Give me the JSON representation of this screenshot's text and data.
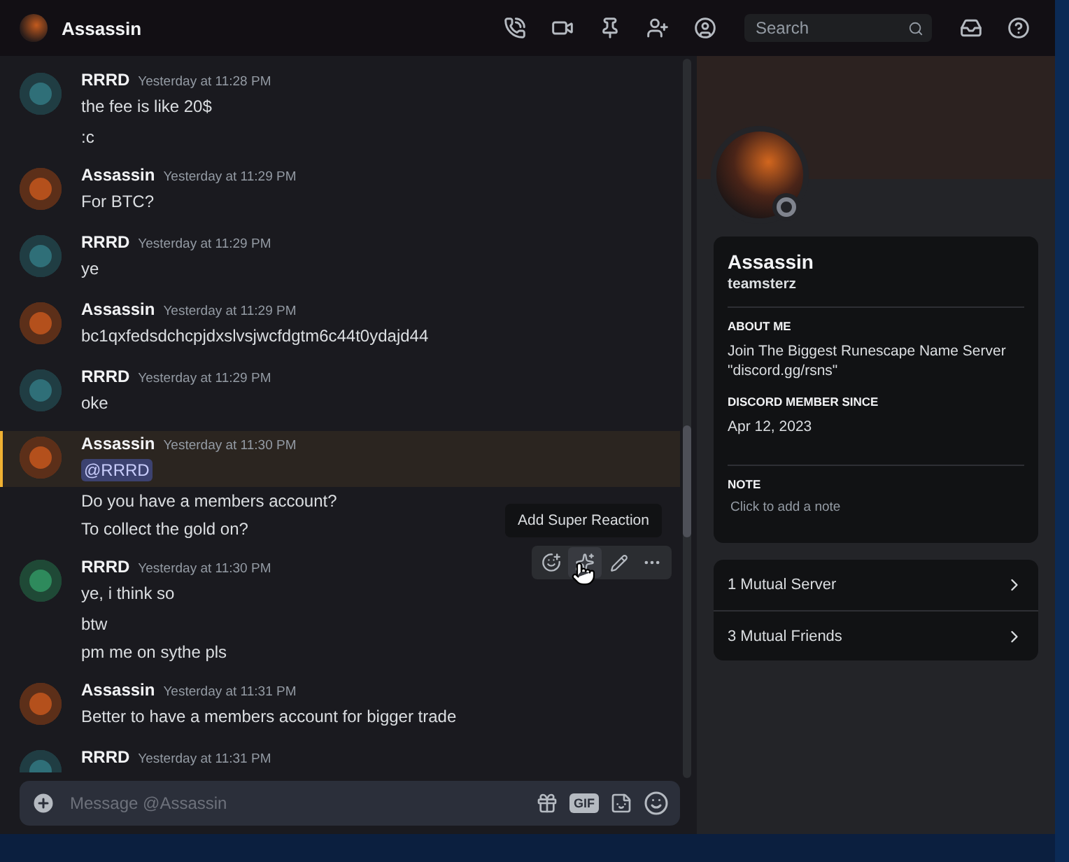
{
  "header": {
    "title": "Assassin",
    "search": {
      "placeholder": "Search"
    }
  },
  "messages": [
    {
      "author": "RRRD",
      "color": "#2f6f78",
      "time": "Yesterday at 11:28 PM",
      "lines": [
        {
          "text": "the fee is like 20$",
          "kind": "text",
          "highlighted": false
        },
        {
          "text": ":c",
          "kind": "text",
          "highlighted": false
        }
      ]
    },
    {
      "author": "Assassin",
      "color": "#b4501c",
      "time": "Yesterday at 11:29 PM",
      "lines": [
        {
          "text": "For BTC?",
          "kind": "text",
          "highlighted": false
        }
      ]
    },
    {
      "author": "RRRD",
      "color": "#2f6f78",
      "time": "Yesterday at 11:29 PM",
      "lines": [
        {
          "text": "ye",
          "kind": "text",
          "highlighted": false
        }
      ]
    },
    {
      "author": "Assassin",
      "color": "#b4501c",
      "time": "Yesterday at 11:29 PM",
      "lines": [
        {
          "text": "bc1qxfedsdchcpjdxslvsjwcfdgtm6c44t0ydajd44",
          "kind": "text",
          "highlighted": false
        }
      ]
    },
    {
      "author": "RRRD",
      "color": "#2f6f78",
      "time": "Yesterday at 11:29 PM",
      "lines": [
        {
          "text": "oke",
          "kind": "text",
          "highlighted": false
        }
      ]
    },
    {
      "author": "Assassin",
      "color": "#b4501c",
      "time": "Yesterday at 11:30 PM",
      "lines": [
        {
          "text": "@RRRD",
          "kind": "mention",
          "highlighted": true
        },
        {
          "text": "Do you have a members account?",
          "kind": "text",
          "highlighted": false
        },
        {
          "text": "To collect the gold on?",
          "kind": "text",
          "highlighted": false
        }
      ]
    },
    {
      "author": "RRRD",
      "color": "#2e8a5c",
      "time": "Yesterday at 11:30 PM",
      "lines": [
        {
          "text": "ye, i think so",
          "kind": "text",
          "highlighted": false
        },
        {
          "text": "btw",
          "kind": "text",
          "highlighted": false
        },
        {
          "text": "pm me on sythe pls",
          "kind": "text",
          "highlighted": false
        }
      ]
    },
    {
      "author": "Assassin",
      "color": "#b4501c",
      "time": "Yesterday at 11:31 PM",
      "lines": [
        {
          "text": "Better to have a members account for bigger trade",
          "kind": "text",
          "highlighted": false
        }
      ]
    },
    {
      "author": "RRRD",
      "color": "#2f6f78",
      "time": "Yesterday at 11:31 PM"
    }
  ],
  "hover_toolbar": {
    "tooltip": "Add Super Reaction"
  },
  "composer": {
    "placeholder": "Message @Assassin",
    "gif_label": "GIF"
  },
  "profile": {
    "display_name": "Assassin",
    "username": "teamsterz",
    "sections": [
      {
        "heading": "ABOUT ME",
        "body": "Join The Biggest Runescape Name Server \"discord.gg/rsns\"",
        "kind": "text"
      },
      {
        "heading": "DISCORD MEMBER SINCE",
        "body": "Apr 12, 2023",
        "kind": "text"
      },
      {
        "heading": "NOTE",
        "body": "Click to add a note",
        "kind": "note"
      }
    ],
    "mutuals": [
      "1 Mutual Server",
      "3 Mutual Friends"
    ]
  }
}
